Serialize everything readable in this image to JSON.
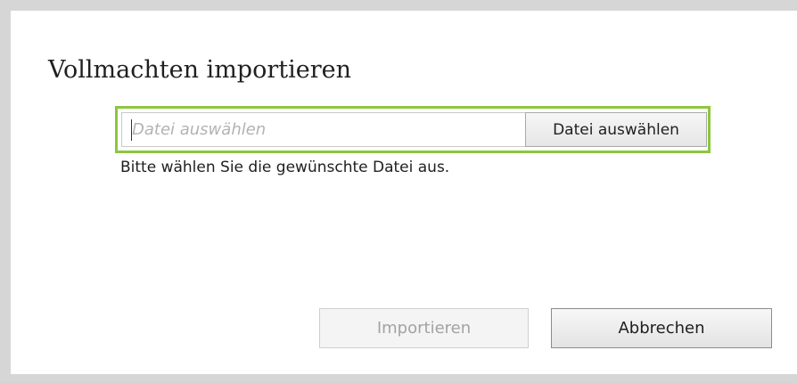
{
  "dialog": {
    "title": "Vollmachten importieren",
    "file_input": {
      "value": "",
      "placeholder": "Datei auswählen"
    },
    "browse_button_label": "Datei auswählen",
    "hint_text": "Bitte wählen Sie die gewünschte Datei aus.",
    "import_button_label": "Importieren",
    "import_button_disabled": true,
    "cancel_button_label": "Abbrechen"
  },
  "colors": {
    "focus_border": "#8dc63f",
    "background": "#d6d6d6",
    "dialog": "#ffffff",
    "disabled_text": "#a3a3a3"
  }
}
